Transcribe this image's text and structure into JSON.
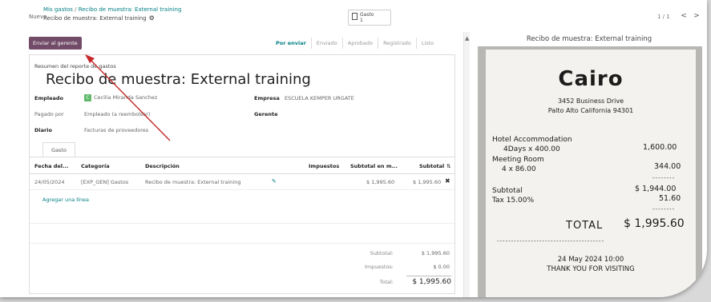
{
  "breadcrumb": {
    "new_label": "Nuevo",
    "parent": "Mis gastos",
    "separator": "/",
    "current": "Recibo de muestra: External training",
    "record": "Recibo de muestra: External training"
  },
  "smart_button": {
    "label": "Gasto",
    "count": "1"
  },
  "pager": {
    "text": "1 / 1",
    "prev": "<",
    "next": ">"
  },
  "actions": {
    "send_label": "Enviar al gerente"
  },
  "stages": [
    "Por enviar",
    "Enviado",
    "Aprobado",
    "Registrado",
    "Listo"
  ],
  "form": {
    "subtitle": "Resumen del reporte de gastos",
    "title": "Recibo de muestra: External training",
    "employee_label": "Empleado",
    "employee_initial": "C",
    "employee_value": "Cecilia Miranda Sanchez",
    "paid_by_label": "Pagado por",
    "paid_by_value": "Empleado (a reembolsar)",
    "journal_label": "Diario",
    "journal_value": "Facturas de proveedores",
    "company_label": "Empresa",
    "company_value": "ESCUELA KEMPER URGATE",
    "manager_label": "Gerente",
    "tab_label": "Gasto"
  },
  "table": {
    "headers": {
      "date": "Fecha del...",
      "category": "Categoría",
      "description": "Descripción",
      "taxes": "Impuestos",
      "subtotal_currency": "Subtotal en m...",
      "subtotal": "Subtotal"
    },
    "row": {
      "date": "24/05/2024",
      "category": "[EXP_GEN] Gastos",
      "description": "Recibo de muestra: External training",
      "subtotal_currency": "$ 1,995.60",
      "subtotal": "$ 1,995.60"
    },
    "add_line": "Agregar una línea"
  },
  "totals": {
    "subtotal_label": "Subtotal:",
    "subtotal_value": "$ 1,995.60",
    "taxes_label": "Impuestos:",
    "taxes_value": "$ 0.00",
    "total_label": "Total:",
    "total_value": "$ 1,995.60"
  },
  "preview": {
    "title": "Recibo de muestra: External training",
    "receipt": {
      "logo": "Cairo",
      "address1": "3452 Business Drive",
      "address2": "Palto Alto California 94301",
      "line1_name": "Hotel Accommodation",
      "line1_detail": "4Days x 400.00",
      "line1_amount": "1,600.00",
      "line2_name": "Meeting Room",
      "line2_detail": "4 x 86.00",
      "line2_amount": "344.00",
      "subtotal_label": "Subtotal",
      "subtotal_amount": "$ 1,944.00",
      "tax_label": "Tax 15.00%",
      "tax_amount": "51.60",
      "total_label": "TOTAL",
      "total_amount": "$ 1,995.60",
      "date": "24 May 2024   10:00",
      "thanks": "THANK YOU FOR VISITING"
    }
  },
  "colors": {
    "primary": "#714b67",
    "accent": "#017e84",
    "annotation": "#c62828"
  }
}
